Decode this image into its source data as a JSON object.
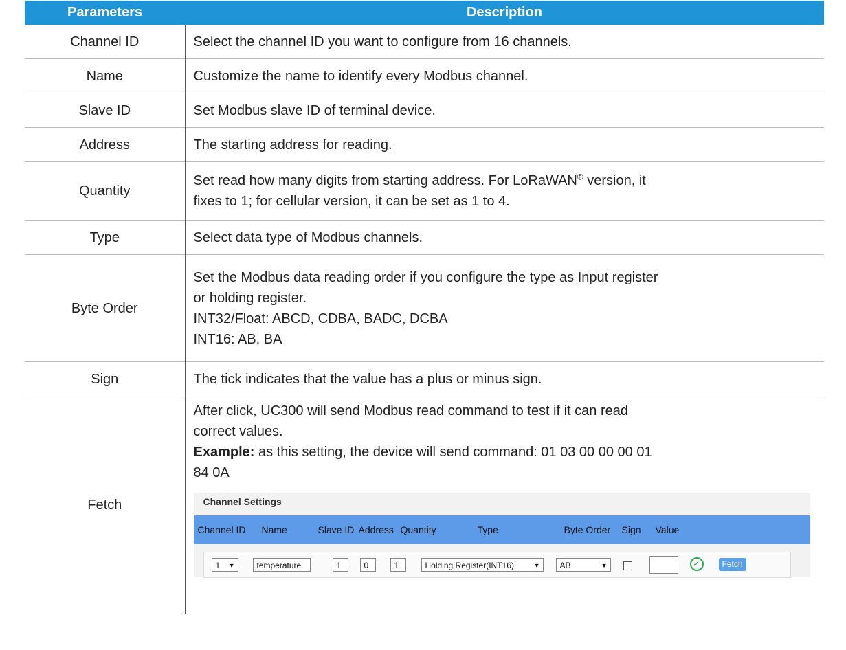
{
  "header": {
    "col1": "Parameters",
    "col2": "Description"
  },
  "rows": [
    {
      "param": "Channel ID",
      "desc": "Select the channel ID you want to configure from 16 channels."
    },
    {
      "param": "Name",
      "desc": "Customize the name to identify every Modbus channel."
    },
    {
      "param": "Slave ID",
      "desc": "Set Modbus slave ID of terminal device."
    },
    {
      "param": "Address",
      "desc": "The starting address for reading."
    },
    {
      "param": "Quantity",
      "desc_line1a": "Set read how many digits from starting address. For LoRaWAN",
      "desc_reg": "®",
      "desc_line1b": " version, it",
      "desc_line2": "fixes to 1; for cellular version, it can be set as 1 to 4."
    },
    {
      "param": "Type",
      "desc": "Select data type of Modbus channels."
    },
    {
      "param": "Byte Order",
      "desc_lines": [
        "Set the Modbus data reading order if you configure the type as Input register",
        "or holding register.",
        "INT32/Float: ABCD, CDBA, BADC, DCBA",
        "INT16: AB, BA"
      ]
    },
    {
      "param": "Sign",
      "desc": "The tick indicates that the value has a plus or minus sign."
    },
    {
      "param": "Fetch",
      "desc_lines": [
        "After click, UC300 will send Modbus read command to test if it can read",
        "correct values."
      ],
      "example_label": "Example:",
      "example_text": " as this setting, the device will send command: 01 03 00 00 00 01",
      "example_text2": "84 0A"
    }
  ],
  "screenshot": {
    "title": "Channel Settings",
    "columns": [
      "Channel ID",
      "Name",
      "Slave ID",
      "Address",
      "Quantity",
      "Type",
      "Byte Order",
      "Sign",
      "Value"
    ],
    "row": {
      "channel_id": "1",
      "name": "temperature",
      "slave_id": "1",
      "address": "0",
      "quantity": "1",
      "type": "Holding Register(INT16)",
      "byte_order": "AB",
      "value": "",
      "fetch_label": "Fetch",
      "dropdown_icon": "chevron-down-icon",
      "ok_icon": "check-circle-icon"
    },
    "colors": {
      "header_bg": "#5d9be9",
      "fetch_bg": "#5aa0e8",
      "ok": "#2daa4a"
    }
  },
  "colors": {
    "table_header_bg": "#1f95d8"
  }
}
